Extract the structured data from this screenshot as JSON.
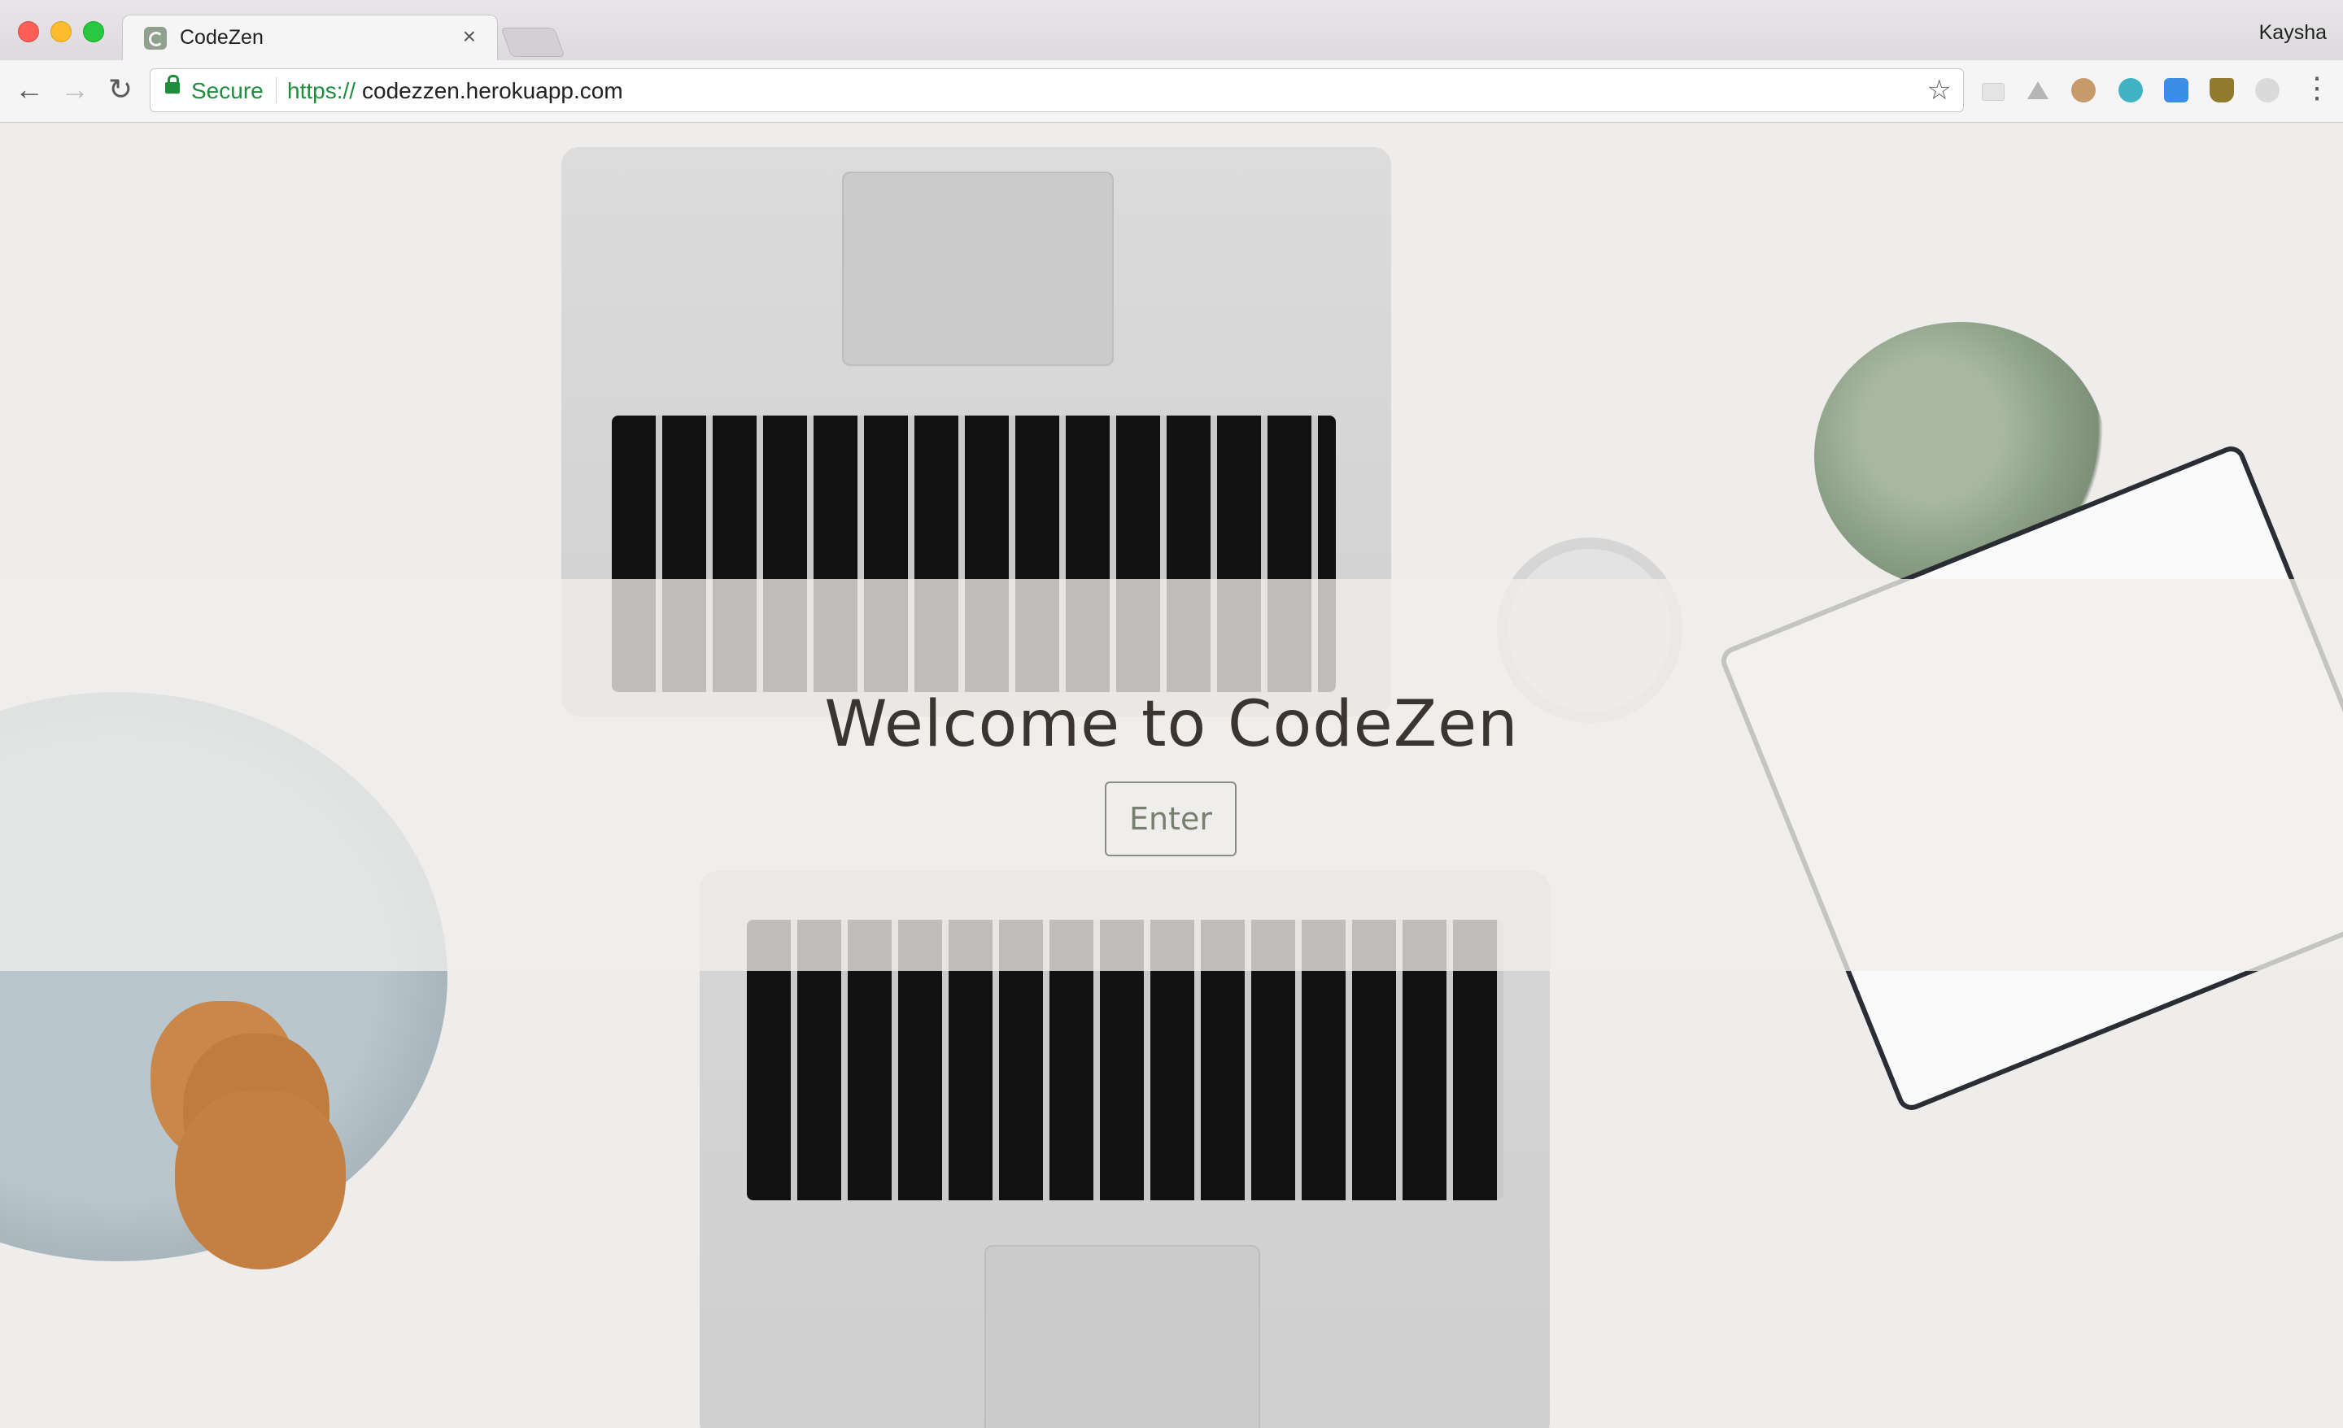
{
  "browser": {
    "tab": {
      "title": "CodeZen",
      "close": "×",
      "favicon": "codezen-favicon"
    },
    "profile_name": "Kaysha",
    "nav": {
      "back": "←",
      "forward": "→",
      "reload": "↻"
    },
    "address_bar": {
      "secure_label": "Secure",
      "url_scheme": "https://",
      "url_host": "codezzen.herokuapp.com"
    },
    "bookmark_star": "☆",
    "extensions": [
      "mail-icon",
      "drive-icon",
      "avatar-icon",
      "m-icon",
      "fi-icon",
      "bag-icon",
      "gear-icon"
    ],
    "menu": "⋮"
  },
  "page": {
    "heading": "Welcome to CodeZen",
    "enter_button": "Enter"
  },
  "colors": {
    "secure": "#1e8e3e",
    "heading": "#3a3530",
    "button_text": "#77806e"
  }
}
